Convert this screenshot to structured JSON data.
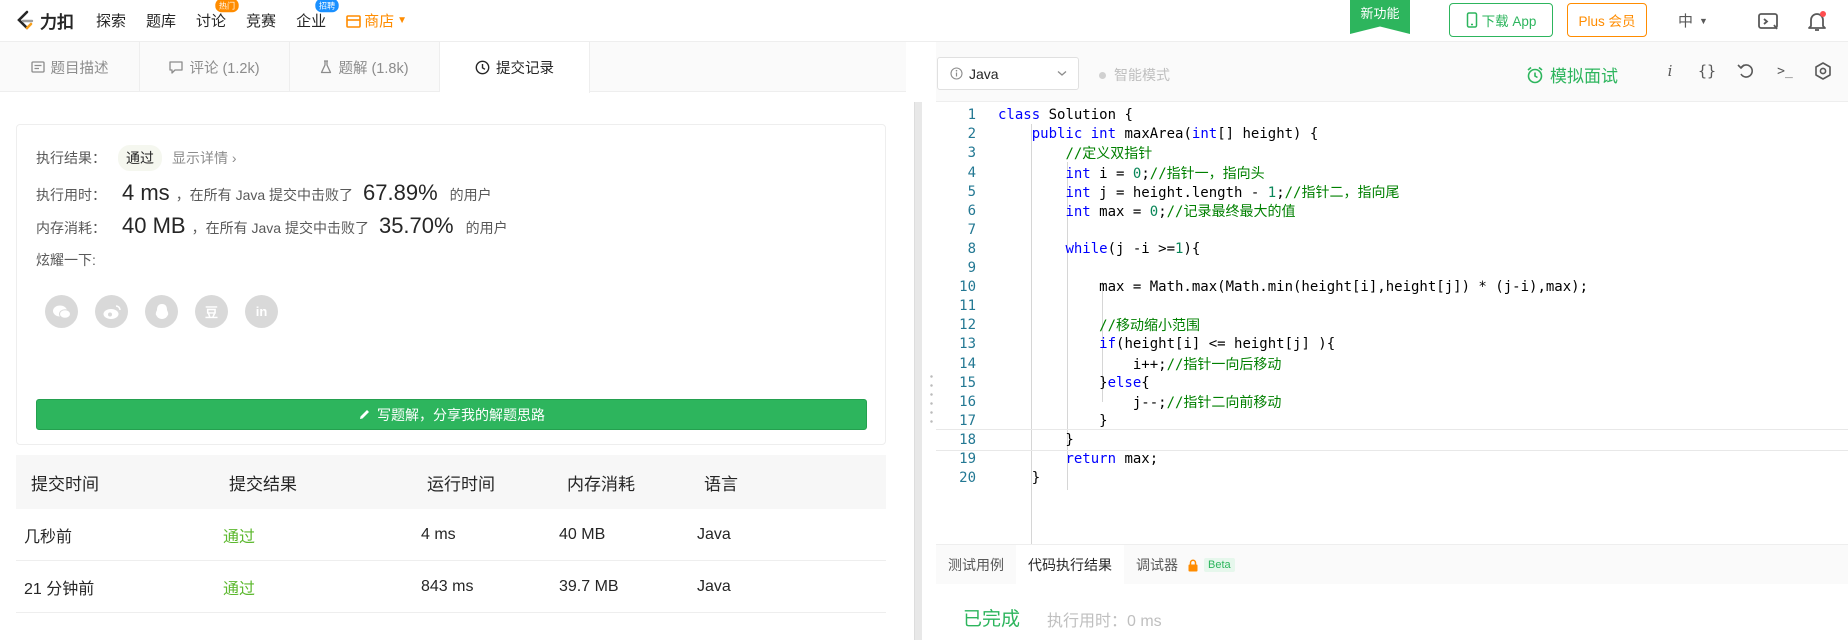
{
  "nav": {
    "logo_text": "力扣",
    "items": [
      "探索",
      "题库",
      "讨论",
      "竞赛",
      "企业"
    ],
    "badge_hot": "热门",
    "badge_hire": "招聘",
    "shop": "商店",
    "new_feature": "新功能",
    "download_app": "下载 App",
    "plus_member": "Plus 会员",
    "lang": "中"
  },
  "tabs": [
    {
      "label": "题目描述",
      "icon": "doc-icon"
    },
    {
      "label": "评论 (1.2k)",
      "icon": "comment-icon"
    },
    {
      "label": "题解 (1.8k)",
      "icon": "flask-icon"
    },
    {
      "label": "提交记录",
      "icon": "clock-icon"
    }
  ],
  "result": {
    "label": "执行结果：",
    "status": "通过",
    "detail_link": "显示详情",
    "time_label": "执行用时：",
    "time_value": "4 ms",
    "time_text": "，在所有 Java 提交中击败了",
    "time_pct": "67.89%",
    "users": "的用户",
    "mem_label": "内存消耗：",
    "mem_value": "40 MB",
    "mem_text": "，在所有 Java 提交中击败了",
    "mem_pct": "35.70%",
    "share_label": "炫耀一下:",
    "share_icons": [
      "wechat-icon",
      "weibo-icon",
      "qq-icon",
      "douban-icon",
      "linkedin-icon"
    ],
    "share_glyphs": {
      "douban": "豆",
      "linkedin": "in"
    },
    "write_button": "写题解，分享我的解题思路"
  },
  "submissions": {
    "headers": [
      "提交时间",
      "提交结果",
      "运行时间",
      "内存消耗",
      "语言"
    ],
    "rows": [
      [
        "几秒前",
        "通过",
        "4 ms",
        "40 MB",
        "Java"
      ],
      [
        "21 分钟前",
        "通过",
        "843 ms",
        "39.7 MB",
        "Java"
      ]
    ]
  },
  "editor": {
    "language": "Java",
    "smart_mode": "智能模式",
    "mock_test": "模拟面试",
    "icon_i": "i",
    "icon_braces": "{}",
    "icon_prompt": ">_"
  },
  "code_lines": [
    "class Solution {",
    "    public int maxArea(int[] height) {",
    "        //定义双指针",
    "        int i = 0;//指针一，指向头",
    "        int j = height.length - 1;//指针二，指向尾",
    "        int max = 0;//记录最终最大的值",
    "",
    "        while(j -i >=1){",
    "",
    "            max = Math.max(Math.min(height[i],height[j]) * (j-i),max);",
    "",
    "            //移动缩小范围",
    "            if(height[i] <= height[j] ){",
    "                i++;//指针一向后移动",
    "            }else{",
    "                j--;//指针二向前移动",
    "            }",
    "        }",
    "        return max;",
    "    }"
  ],
  "console": {
    "tabs": [
      "测试用例",
      "代码执行结果",
      "调试器"
    ],
    "beta": "Beta",
    "done": "已完成",
    "exec_time": "执行用时：0 ms"
  }
}
